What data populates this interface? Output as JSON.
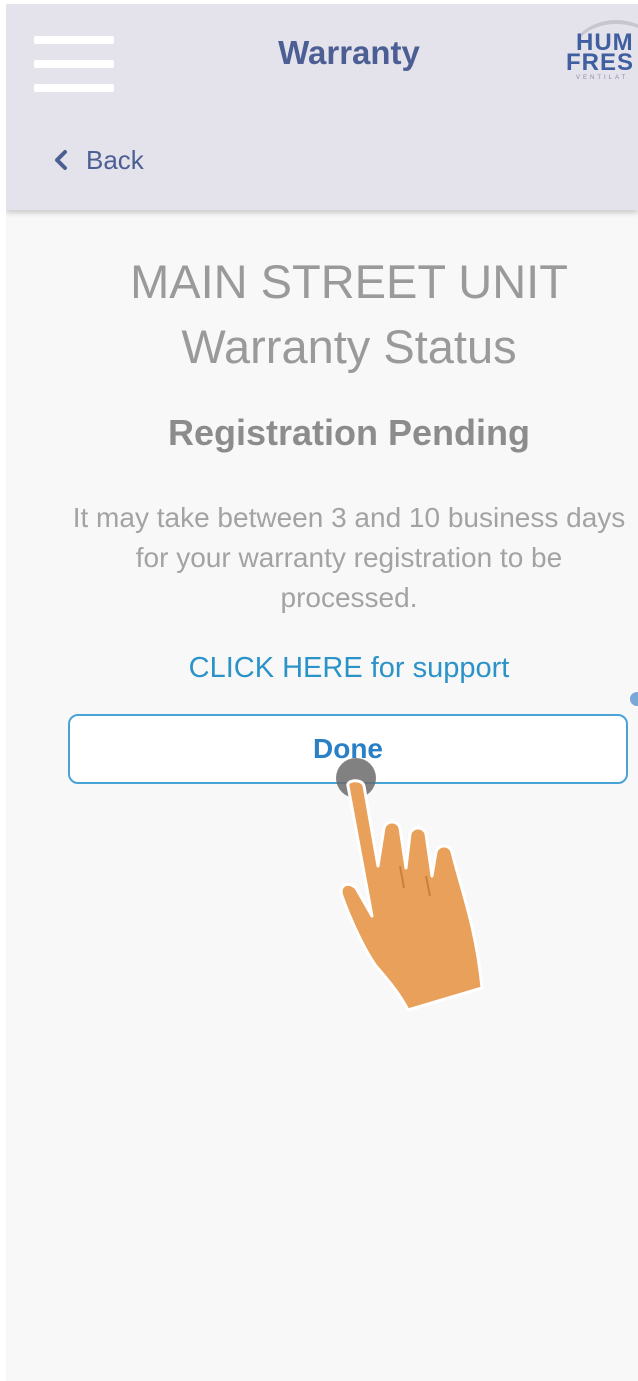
{
  "header": {
    "title": "Warranty",
    "logo": {
      "line1": "HUM",
      "line2": "FRES",
      "line3": "VENTILAT"
    },
    "menu_icon": "hamburger-menu-icon"
  },
  "nav": {
    "back_label": "Back",
    "back_icon": "chevron-left-icon"
  },
  "main": {
    "unit_name": "MAIN STREET UNIT",
    "status_heading": "Warranty Status",
    "status": "Registration Pending",
    "description": "It may take between 3 and 10 business days\nfor your warranty registration to be\nprocessed.",
    "support_link": "CLICK HERE for support",
    "done_button": "Done"
  },
  "colors": {
    "header_bg": "#e4e2ea",
    "accent": "#4c5f94",
    "link": "#2b93c7",
    "button_border": "#4aa3d6",
    "text_muted": "#9a9a9a",
    "hand": "#e9a05a"
  }
}
